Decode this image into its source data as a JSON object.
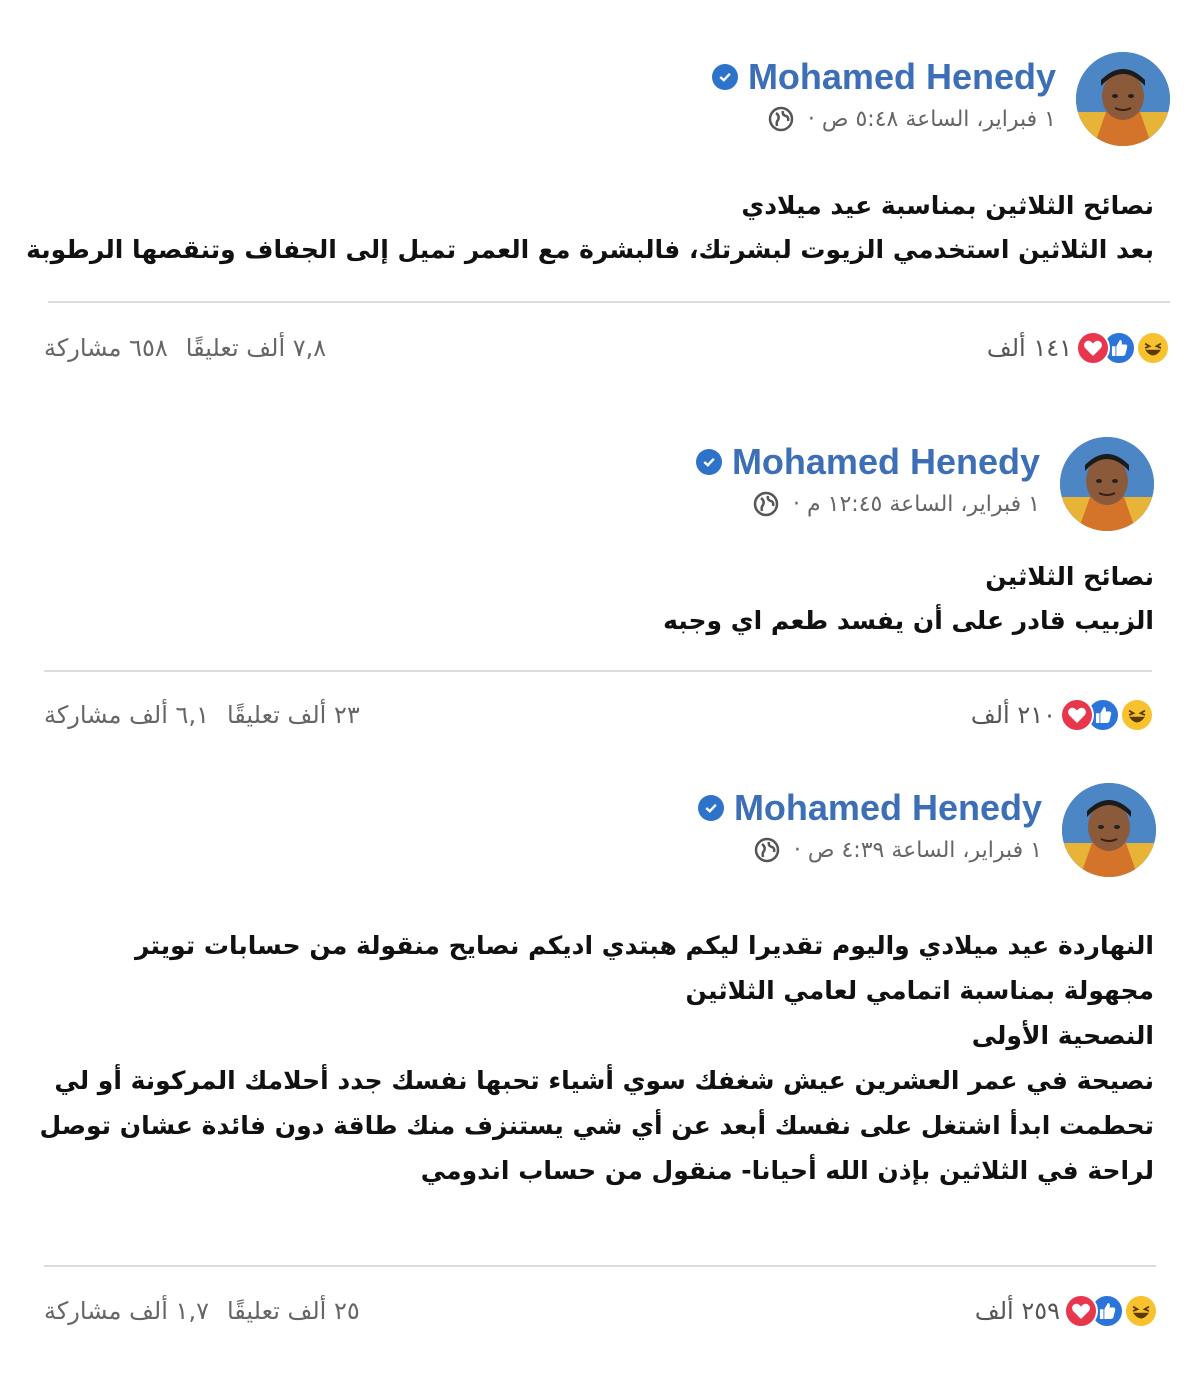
{
  "posts": [
    {
      "author": "Mohamed Henedy",
      "meta": "١ فبراير، الساعة ٥:٤٨ ص ·",
      "body_lines": [
        "نصائح الثلاثين بمناسبة عيد ميلادي",
        "بعد الثلاثين استخدمي الزيوت لبشرتك، فالبشرة مع العمر تميل إلى الجفاف وتنقصها الرطوبة"
      ],
      "reactions_count": "١٤١ ألف",
      "comments": "٧,٨ ألف تعليقًا",
      "shares": "٦٥٨ مشاركة"
    },
    {
      "author": "Mohamed Henedy",
      "meta": "١ فبراير، الساعة ١٢:٤٥ م ·",
      "body_lines": [
        "نصائح الثلاثين",
        "الزبيب قادر على أن يفسد طعم اي وجبه"
      ],
      "reactions_count": "٢١٠ ألف",
      "comments": "٢٣ ألف تعليقًا",
      "shares": "٦,١ ألف مشاركة"
    },
    {
      "author": "Mohamed Henedy",
      "meta": "١ فبراير، الساعة ٤:٣٩ ص ·",
      "body_lines": [
        "النهاردة عيد ميلادي واليوم تقديرا ليكم هبتدي اديكم نصايح منقولة من حسابات تويتر",
        "مجهولة بمناسبة اتمامي لعامي الثلاثين",
        "النصحية الأولى",
        "نصيحة في عمر العشرين عيش شغفك سوي أشياء تحبها نفسك جدد أحلامك المركونة أو لي",
        "تحطمت ابدأ اشتغل على نفسك أبعد عن أي شي يستنزف منك طاقة دون فائدة عشان توصل",
        "لراحة في الثلاثين بإذن الله أحيانا- منقول من حساب اندومي"
      ],
      "reactions_count": "٢٥٩ ألف",
      "comments": "٢٥ ألف تعليقًا",
      "shares": "١,٧ ألف مشاركة"
    }
  ],
  "colors": {
    "author": "#3d6fb6",
    "verified": "#2d73c9",
    "like": "#2b74d9",
    "love": "#e8364c",
    "haha": "#f7c22e"
  },
  "icons": [
    "verified-badge-icon",
    "globe-icon",
    "haha-reaction-icon",
    "like-reaction-icon",
    "love-reaction-icon"
  ]
}
